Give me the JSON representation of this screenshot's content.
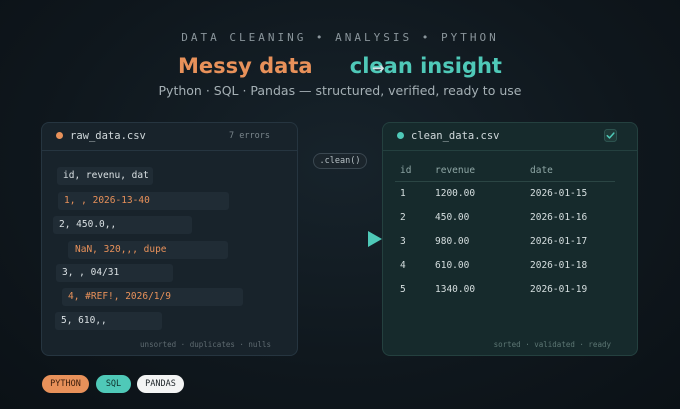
{
  "header": {
    "kicker": "DATA CLEANING • ANALYSIS • PYTHON",
    "headline_left": "Messy data",
    "headline_arrow": "→",
    "headline_right": "clean insight",
    "subtitle": "Python · SQL · Pandas — structured, verified, ready to use"
  },
  "raw_panel": {
    "filename": "raw_data.csv",
    "error_count": "7 errors",
    "rows": [
      "id, revenu, dat",
      "1, , 2026-13-40",
      "2, 450.0,,",
      "NaN, 320,,, dupe",
      "3, , 04/31",
      "4, #REF!, 2026/1/9",
      "5, 610,,"
    ],
    "footer": "unsorted · duplicates · nulls"
  },
  "transform": {
    "label": ".clean()"
  },
  "clean_panel": {
    "filename": "clean_data.csv",
    "columns": [
      "id",
      "revenue",
      "date"
    ],
    "rows": [
      [
        "1",
        "1200.00",
        "2026-01-15"
      ],
      [
        "2",
        "450.00",
        "2026-01-16"
      ],
      [
        "3",
        "980.00",
        "2026-01-17"
      ],
      [
        "4",
        "610.00",
        "2026-01-18"
      ],
      [
        "5",
        "1340.00",
        "2026-01-19"
      ]
    ],
    "footer": "sorted · validated · ready"
  },
  "tags": [
    "PYTHON",
    "SQL",
    "PANDAS"
  ],
  "colors": {
    "messy": "#e8915a",
    "clean": "#4fc9b8",
    "background": "#0f171d"
  }
}
